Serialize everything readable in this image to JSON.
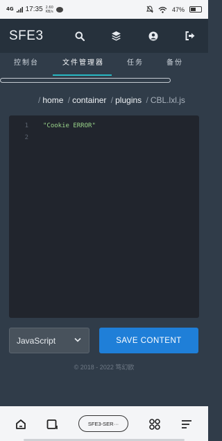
{
  "status_bar": {
    "signal": "4G",
    "time": "17:35",
    "speed_value": "2.60",
    "speed_unit": "KB/s",
    "battery": "47%"
  },
  "header": {
    "brand": "SFE3",
    "icons": [
      "search-icon",
      "layers-icon",
      "user-icon",
      "logout-icon"
    ]
  },
  "tabs": [
    {
      "label": "控制台",
      "active": false
    },
    {
      "label": "文件管理器",
      "active": true
    },
    {
      "label": "任务",
      "active": false
    },
    {
      "label": "备份",
      "active": false
    }
  ],
  "breadcrumb": {
    "items": [
      "home",
      "container",
      "plugins"
    ],
    "current": "CBL.lxl.js",
    "separator": "/"
  },
  "editor": {
    "lines": [
      {
        "number": "1",
        "text": "\"Cookie ERROR\""
      },
      {
        "number": "2",
        "text": ""
      }
    ]
  },
  "language_select": {
    "value": "JavaScript"
  },
  "save_button": {
    "label": "SAVE CONTENT"
  },
  "footer": {
    "text": "© 2018 - 2022 笃幻欧"
  },
  "browser_nav": {
    "tab_label": "SFE3-SER···"
  },
  "colors": {
    "accent": "#28b8c3",
    "primary_button": "#1f7fd8",
    "header_bg": "#26313c",
    "page_bg": "#303c49",
    "editor_bg": "#21252d",
    "string": "#9ad48a"
  }
}
